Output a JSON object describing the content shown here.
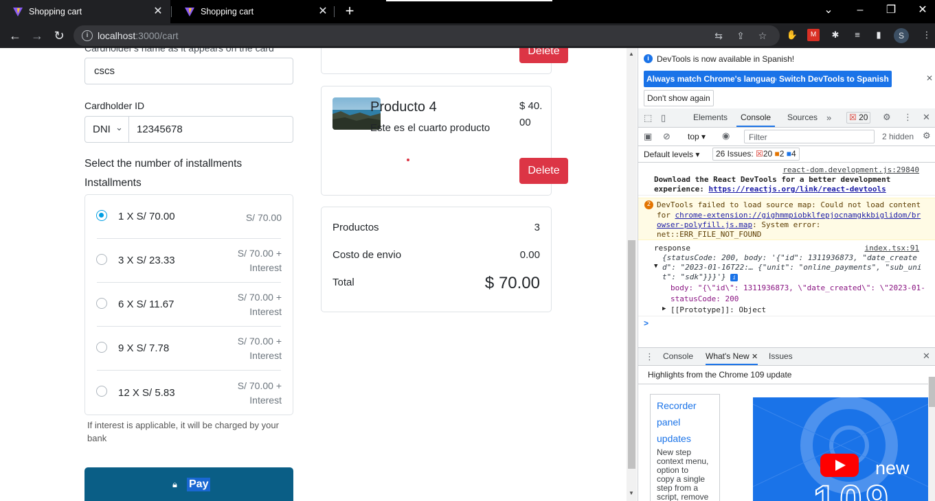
{
  "browser": {
    "tabs": [
      {
        "title": "Shopping cart"
      },
      {
        "title": "Shopping cart"
      }
    ],
    "tab_close": "✕",
    "new_tab": "+",
    "url_host": "localhost",
    "url_path": ":3000/cart",
    "profile_initial": "S"
  },
  "form": {
    "cardholder_name_label": "Cardholder's name as it appears on the card",
    "cardholder_name_value": "cscs",
    "cardholder_id_label": "Cardholder ID",
    "id_type": "DNI",
    "id_value": "12345678",
    "installments_heading": "Select the number of installments",
    "installments_label": "Installments",
    "installments": [
      {
        "label": "1 X S/ 70.00",
        "price_line1": "S/ 70.00",
        "price_line2": "",
        "checked": true
      },
      {
        "label": "3 X S/ 23.33",
        "price_line1": "S/ 70.00 +",
        "price_line2": "Interest",
        "checked": false
      },
      {
        "label": "6 X S/ 11.67",
        "price_line1": "S/ 70.00 +",
        "price_line2": "Interest",
        "checked": false
      },
      {
        "label": "9 X S/ 7.78",
        "price_line1": "S/ 70.00 +",
        "price_line2": "Interest",
        "checked": false
      },
      {
        "label": "12 X S/ 5.83",
        "price_line1": "S/ 70.00 +",
        "price_line2": "Interest",
        "checked": false
      }
    ],
    "interest_note": "If interest is applicable, it will be charged by your bank",
    "pay_label": "Pay"
  },
  "cart": {
    "delete_label": "Delete",
    "product": {
      "title": "Producto 4",
      "description": "Este es el cuarto producto",
      "price": "$ 40.00"
    },
    "summary": {
      "products_label": "Productos",
      "products_value": "3",
      "shipping_label": "Costo de envio",
      "shipping_value": "0.00",
      "total_label": "Total",
      "total_value": "$ 70.00"
    }
  },
  "devtools": {
    "banner_text": "DevTools is now available in Spanish!",
    "btn_match": "Always match Chrome's language",
    "btn_switch": "Switch DevTools to Spanish",
    "btn_dont_show": "Don't show again",
    "tabs": [
      "Elements",
      "Console",
      "Sources"
    ],
    "error_count": "20",
    "context": "top",
    "filter_placeholder": "Filter",
    "hidden_count": "2 hidden",
    "levels": "Default levels",
    "issues_label": "26 Issues:",
    "issues_errors": "20",
    "issues_warnings": "2",
    "issues_info": "4",
    "msg1_source": "react-dom.development.js:29840",
    "msg1_line1": "Download the React DevTools for a better development",
    "msg1_line2_prefix": "experience: ",
    "msg1_link": "https://reactjs.org/link/react-devtools",
    "msg2_count": "2",
    "msg2_line1": "DevTools failed to load source map: Could not load content",
    "msg2_line2_prefix": "for ",
    "msg2_link_a": "chrome-extension://gighmmpiobklfepjocnamgkkbiglidom/br",
    "msg2_link_b": "owser-polyfill.js.map",
    "msg2_line3_suffix": ": System error:",
    "msg2_line4": "net::ERR_FILE_NOT_FOUND",
    "msg3_label": "response",
    "msg3_source": "index.tsx:91",
    "msg3_obj1": "{statusCode: 200, body: '{\"id\": 1311936873, \"date_create",
    "msg3_obj2": "d\": \"2023-01-16T22:… {\"unit\": \"online_payments\", \"sub_uni",
    "msg3_obj3": "t\": \"sdk\"}}}'}",
    "msg3_body": "body: \"{\\\"id\\\": 1311936873, \\\"date_created\\\": \\\"2023-01-",
    "msg3_status": "statusCode: 200",
    "msg3_proto": "[[Prototype]]: Object",
    "prompt": ">",
    "drawer_tabs": [
      "Console",
      "What's New",
      "Issues"
    ],
    "whats_new_heading": "Highlights from the Chrome 109 update",
    "recorder_title": [
      "Recorder",
      "panel",
      "updates"
    ],
    "recorder_desc": [
      "New step",
      "context menu,",
      "option to",
      "copy a single",
      "step from a",
      "script, remove"
    ],
    "video_caption": "new",
    "video_number": "109"
  }
}
